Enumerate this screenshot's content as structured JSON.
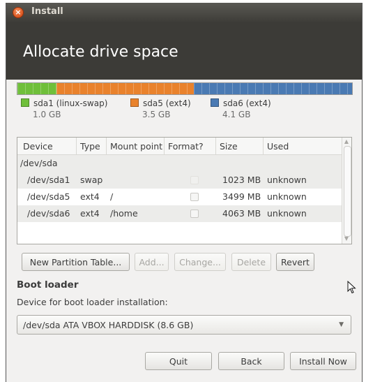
{
  "window": {
    "title": "Install"
  },
  "header": {
    "title": "Allocate drive space"
  },
  "usage_bar": [
    {
      "label": "sda1 (linux-swap)",
      "size": "1.0 GB",
      "color": "#6fbf3a",
      "fraction": 0.116
    },
    {
      "label": "sda5 (ext4)",
      "size": "3.5 GB",
      "color": "#e9822c",
      "fraction": 0.407
    },
    {
      "label": "sda6 (ext4)",
      "size": "4.1 GB",
      "color": "#4a7ab3",
      "fraction": 0.477
    }
  ],
  "table": {
    "headers": [
      "Device",
      "Type",
      "Mount point",
      "Format?",
      "Size",
      "Used"
    ],
    "group": "/dev/sda",
    "rows": [
      {
        "device": "/dev/sda1",
        "type": "swap",
        "mount": "",
        "size": "1023 MB",
        "used": "unknown"
      },
      {
        "device": "/dev/sda5",
        "type": "ext4",
        "mount": "/",
        "size": "3499 MB",
        "used": "unknown"
      },
      {
        "device": "/dev/sda6",
        "type": "ext4",
        "mount": "/home",
        "size": "4063 MB",
        "used": "unknown"
      }
    ]
  },
  "partition_buttons": {
    "new_table": "New Partition Table...",
    "add": "Add...",
    "change": "Change...",
    "delete": "Delete",
    "revert": "Revert"
  },
  "boot_loader": {
    "heading": "Boot loader",
    "label": "Device for boot loader installation:",
    "selected": "/dev/sda ATA VBOX HARDDISK (8.6 GB)"
  },
  "footer": {
    "quit": "Quit",
    "back": "Back",
    "install": "Install Now"
  },
  "icons": {
    "close": "close-icon",
    "dropdown": "chevron-down-icon",
    "cursor": "mouse-pointer-icon"
  }
}
